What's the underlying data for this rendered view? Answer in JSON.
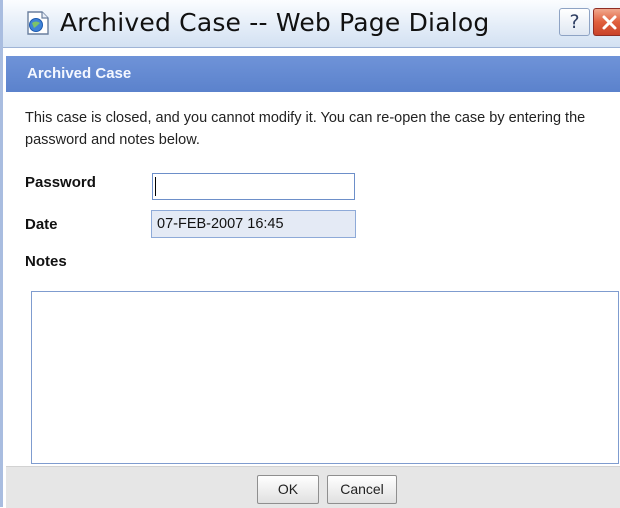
{
  "window": {
    "title": "Archived Case -- Web Page Dialog",
    "help_label": "?",
    "icon": "browser-page-icon",
    "close_icon": "close-icon"
  },
  "dialog": {
    "header": "Archived Case",
    "message": "This case is closed, and you cannot modify it. You can re-open the case by entering the password and notes below."
  },
  "form": {
    "password_label": "Password",
    "password_value": "",
    "date_label": "Date",
    "date_value": "07-FEB-2007 16:45",
    "notes_label": "Notes",
    "notes_value": ""
  },
  "buttons": {
    "ok": "OK",
    "cancel": "Cancel"
  },
  "colors": {
    "header_band": "#5b82cc",
    "titlebar": "#dce7f5",
    "close_button": "#d9573a",
    "footer": "#e6e6e6"
  }
}
